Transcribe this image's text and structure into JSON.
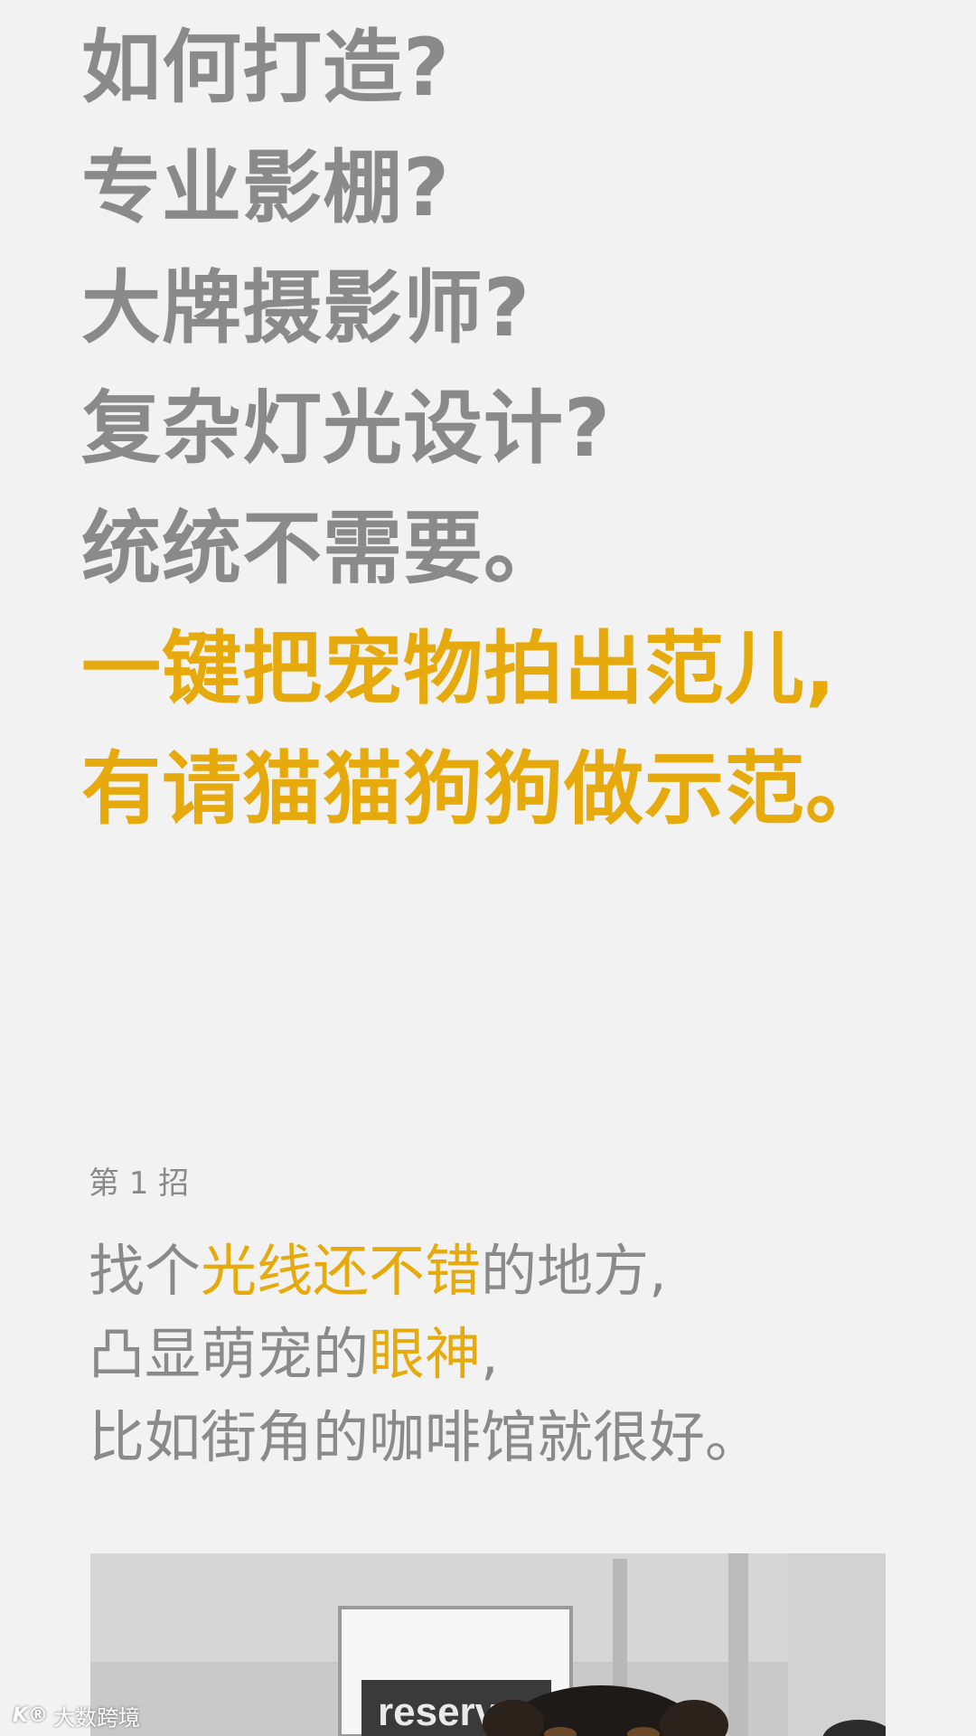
{
  "headline": {
    "lines": [
      "如何打造?",
      "专业影棚?",
      "大牌摄影师?",
      "复杂灯光设计?",
      "统统不需要。"
    ],
    "accent_lines": [
      "一键把宠物拍出范儿,",
      "有请猫猫狗狗做示范。"
    ]
  },
  "tip": {
    "step_label": "第 1 招",
    "line1": {
      "pre": "找个",
      "hi": "光线还不错",
      "post": "的地方,"
    },
    "line2": {
      "pre": "凸显萌宠的",
      "hi": "眼神",
      "post": ","
    },
    "line3": "比如街角的咖啡馆就很好。"
  },
  "photo": {
    "sign_text": "reserve"
  },
  "watermark": {
    "logo": "K®",
    "text": "大数跨境"
  },
  "colors": {
    "background": "#f2f2f2",
    "text_gray": "#8a8a8a",
    "accent": "#e6aa0d"
  }
}
